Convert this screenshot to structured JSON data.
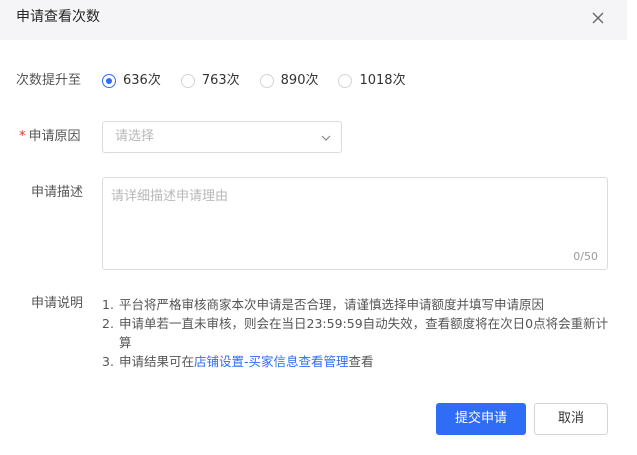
{
  "dialog": {
    "title": "申请查看次数",
    "close_icon": "close-icon"
  },
  "form": {
    "times_label": "次数提升至",
    "times_options": [
      {
        "label": "636次",
        "checked": true
      },
      {
        "label": "763次",
        "checked": false
      },
      {
        "label": "890次",
        "checked": false
      },
      {
        "label": "1018次",
        "checked": false
      }
    ],
    "reason_required_mark": "*",
    "reason_label": "申请原因",
    "reason_placeholder": "请选择",
    "reason_icon": "chevron-down-icon",
    "desc_label": "申请描述",
    "desc_placeholder": "请详细描述申请理由",
    "desc_counter": "0/50",
    "notes_label": "申请说明",
    "notes": {
      "item1_num": "1.",
      "item1_text": "平台将严格审核商家本次申请是否合理，请谨慎选择申请额度并填写申请原因",
      "item2_num": "2.",
      "item2_text": "申请单若一直未审核，则会在当日23:59:59自动失效，查看额度将在次日0点将会重新计算",
      "item3_num": "3.",
      "item3_prefix": "申请结果可在",
      "item3_link": "店铺设置-买家信息查看管理",
      "item3_suffix": "查看"
    }
  },
  "buttons": {
    "submit_label": "提交申请",
    "cancel_label": "取消"
  },
  "colors": {
    "primary": "#2f6df6",
    "required": "#e5302f",
    "header_bg": "#f5f5f7"
  }
}
